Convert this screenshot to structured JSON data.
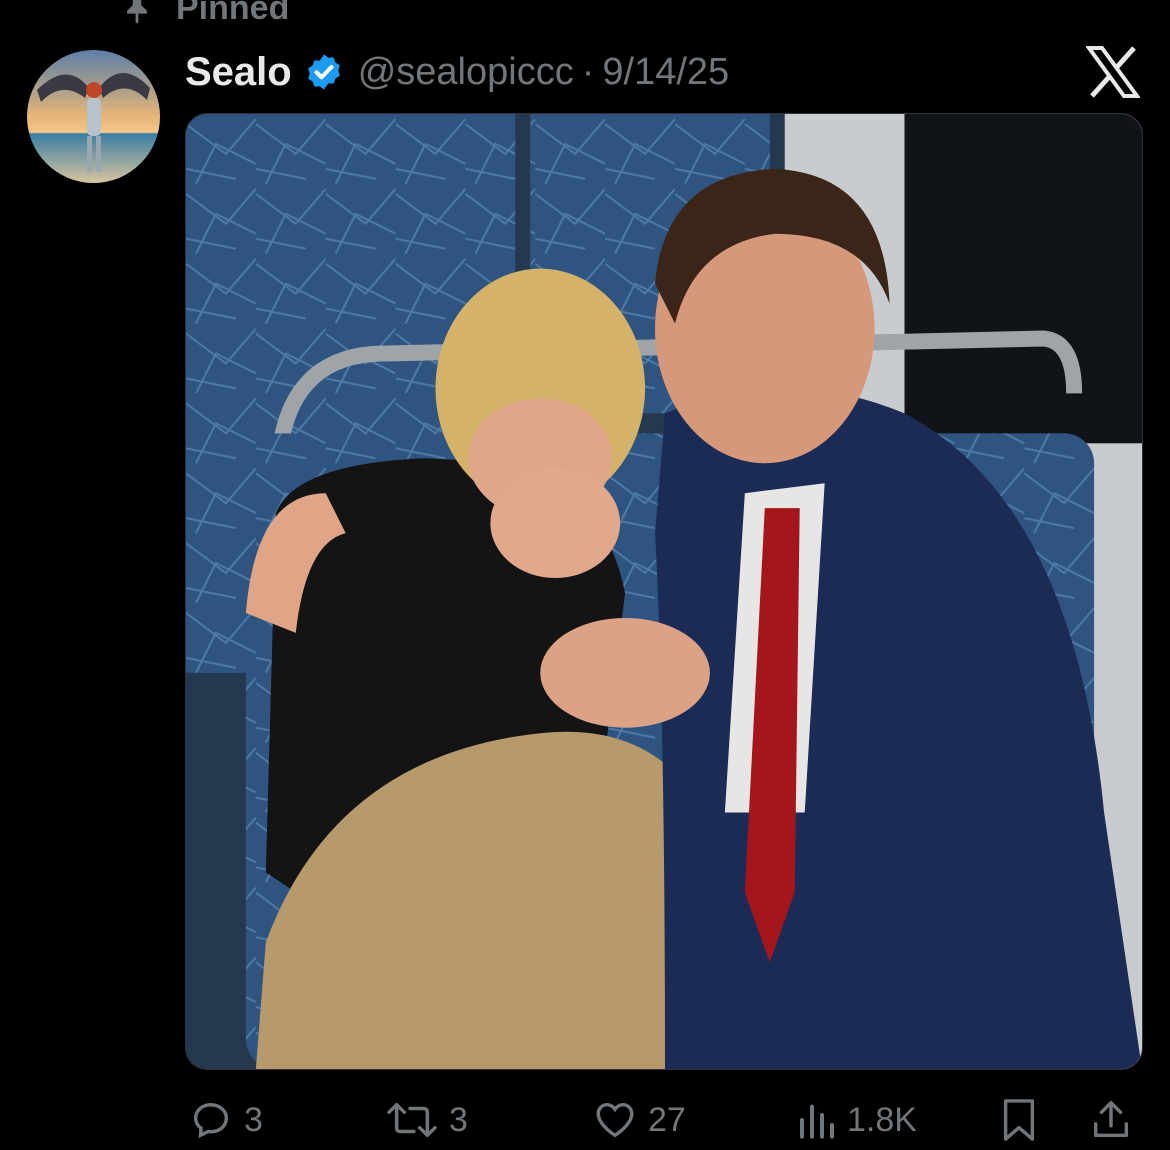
{
  "pinned_label": "Pinned",
  "tweet": {
    "display_name": "Sealo",
    "handle": "@sealopiccc",
    "separator": "·",
    "date": "9/14/25",
    "verified": true
  },
  "actions": {
    "replies": "3",
    "reposts": "3",
    "likes": "27",
    "views": "1.8K"
  },
  "icons": {
    "pin": "pin-icon",
    "verified": "verified-badge-icon",
    "x": "x-logo-icon",
    "reply": "reply-icon",
    "repost": "repost-icon",
    "like": "heart-icon",
    "views": "views-chart-icon",
    "bookmark": "bookmark-icon",
    "share": "share-icon"
  },
  "colors": {
    "background": "#000000",
    "text_primary": "#e7e9ea",
    "text_secondary": "#71767b",
    "verified_blue": "#1d9bf0"
  }
}
